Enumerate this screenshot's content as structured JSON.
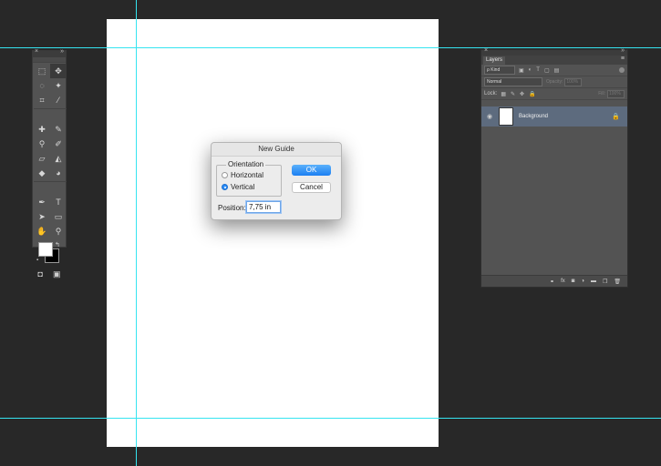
{
  "window": {
    "background_color": "#282828",
    "guide_color": "#35e4f0"
  },
  "tools_panel": {
    "close_glyph": "×",
    "collapse_glyph": "»",
    "tools": [
      {
        "name": "marquee-icon",
        "glyph": "⬚"
      },
      {
        "name": "move-icon",
        "glyph": "✥",
        "active": true
      },
      {
        "name": "lasso-icon",
        "glyph": "◌"
      },
      {
        "name": "magic-wand-icon",
        "glyph": "✦"
      },
      {
        "name": "crop-icon",
        "glyph": "⌗"
      },
      {
        "name": "eyedropper-icon",
        "glyph": "⁄"
      },
      {
        "name": "healing-brush-icon",
        "glyph": "✚"
      },
      {
        "name": "brush-icon",
        "glyph": "✎"
      },
      {
        "name": "clone-stamp-icon",
        "glyph": "⚲"
      },
      {
        "name": "history-brush-icon",
        "glyph": "✐"
      },
      {
        "name": "eraser-icon",
        "glyph": "▱"
      },
      {
        "name": "paint-bucket-icon",
        "glyph": "◭"
      },
      {
        "name": "blur-icon",
        "glyph": "◆"
      },
      {
        "name": "dodge-icon",
        "glyph": "◕"
      },
      {
        "name": "pen-icon",
        "glyph": "✒"
      },
      {
        "name": "type-icon",
        "glyph": "T"
      },
      {
        "name": "path-selection-icon",
        "glyph": "➤"
      },
      {
        "name": "rectangle-icon",
        "glyph": "▭"
      },
      {
        "name": "hand-icon",
        "glyph": "✋"
      },
      {
        "name": "zoom-icon",
        "glyph": "⚲"
      }
    ],
    "foreground_color": "#ffffff",
    "background_color": "#000000"
  },
  "dialog": {
    "title": "New Guide",
    "orientation_label": "Orientation",
    "horizontal_label": "Horizontal",
    "vertical_label": "Vertical",
    "selected_orientation": "Vertical",
    "ok_label": "OK",
    "cancel_label": "Cancel",
    "position_label": "Position:",
    "position_value": "7,75 in"
  },
  "layers_panel": {
    "close_glyph": "×",
    "collapse_glyph": "»",
    "tab_label": "Layers",
    "menu_glyph": "≡",
    "kind_label": "ρ Kind",
    "blend_mode": "Normal",
    "opacity_label": "Opacity:",
    "opacity_value": "100%",
    "lock_label": "Lock:",
    "fill_label": "Fill:",
    "fill_value": "100%",
    "layers": [
      {
        "name": "Background",
        "locked": true,
        "visible": true
      }
    ],
    "footer_icons": [
      {
        "name": "link-layers-icon",
        "glyph": "⚭"
      },
      {
        "name": "layer-style-icon",
        "glyph": "fx"
      },
      {
        "name": "layer-mask-icon",
        "glyph": "◙"
      },
      {
        "name": "adjustment-layer-icon",
        "glyph": "◑"
      },
      {
        "name": "new-group-icon",
        "glyph": "▬"
      },
      {
        "name": "new-layer-icon",
        "glyph": "❐"
      },
      {
        "name": "delete-layer-icon",
        "glyph": "🗑"
      }
    ]
  }
}
